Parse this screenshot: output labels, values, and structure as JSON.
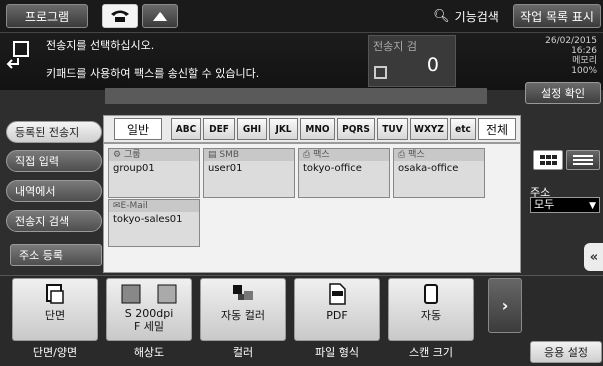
{
  "topbar": {
    "program_label": "프로그램",
    "search_label": "기능검색",
    "joblist_label": "작업 목록 표시"
  },
  "info": {
    "message1": "전송지를 선택하십시오.",
    "message2": "키패드를 사용하여 팩스를 송신할 수 있습니다.",
    "dest_label": "전송지 검",
    "dest_count": "0",
    "date": "26/02/2015",
    "time": "16:26",
    "memory_label": "메모리",
    "memory_value": "100%",
    "confirm_label": "설정 확인"
  },
  "nav": {
    "registered": "등록된 전송지",
    "direct": "직접 입력",
    "history": "내역에서",
    "search": "전송지 검색",
    "register": "주소 등록"
  },
  "tabs": [
    "일반",
    "ABC",
    "DEF",
    "GHI",
    "JKL",
    "MNO",
    "PQRS",
    "TUV",
    "WXYZ",
    "etc",
    "전체"
  ],
  "cards": [
    {
      "type": "그룹",
      "name": "group01"
    },
    {
      "type": "SMB",
      "name": "user01"
    },
    {
      "type": "팩스",
      "name": "tokyo-office"
    },
    {
      "type": "팩스",
      "name": "osaka-office"
    },
    {
      "type": "E-Mail",
      "name": "tokyo-sales01"
    }
  ],
  "side": {
    "addr_label": "주소",
    "addr_value": "모두"
  },
  "functions": [
    {
      "value": "단면",
      "label": "단면/양면"
    },
    {
      "value": "S 200dpi\nF 세밀",
      "label": "해상도"
    },
    {
      "value": "자동 컬러",
      "label": "컬러"
    },
    {
      "value": "PDF",
      "label": "파일 형식"
    },
    {
      "value": "자동",
      "label": "스캔 크기"
    }
  ],
  "app_setting": "응용 설정"
}
